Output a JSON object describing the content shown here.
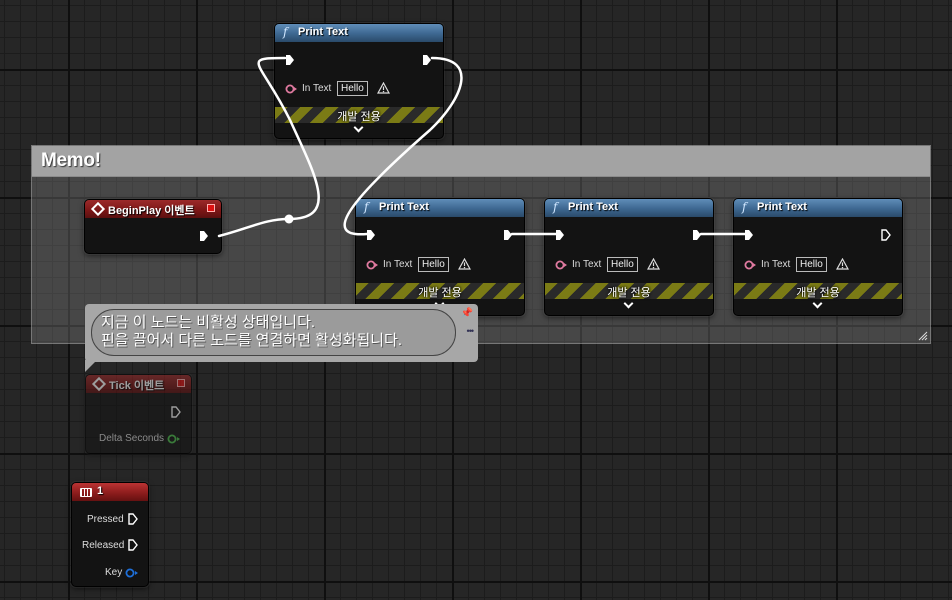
{
  "comment": {
    "title": "Memo!"
  },
  "nodes": {
    "print_top": {
      "title": "Print Text",
      "in_text_label": "In Text",
      "in_text_value": "Hello",
      "dev_only": "개발 전용"
    },
    "print_1": {
      "title": "Print Text",
      "in_text_label": "In Text",
      "in_text_value": "Hello",
      "dev_only": "개발 전용"
    },
    "print_2": {
      "title": "Print Text",
      "in_text_label": "In Text",
      "in_text_value": "Hello",
      "dev_only": "개발 전용"
    },
    "print_3": {
      "title": "Print Text",
      "in_text_label": "In Text",
      "in_text_value": "Hello",
      "dev_only": "개발 전용"
    },
    "begin_play": {
      "title": "BeginPlay 이벤트"
    },
    "tick": {
      "title": "Tick 이벤트",
      "delta_label": "Delta Seconds"
    },
    "key": {
      "title": "1",
      "pressed": "Pressed",
      "released": "Released",
      "key": "Key"
    }
  },
  "tooltip": {
    "line1": "지금 이 노드는 비활성 상태입니다.",
    "line2": "핀을 끌어서 다른 노드를 연결하면 활성화됩니다."
  },
  "colors": {
    "function_header": "#3d6790",
    "event_header": "#7a1616",
    "string_pin": "#e07aa0",
    "float_pin": "#4cc24c",
    "struct_pin": "#1e6fd9",
    "exec_wire": "#ffffff",
    "dev_stripe": "#7b7b15"
  }
}
